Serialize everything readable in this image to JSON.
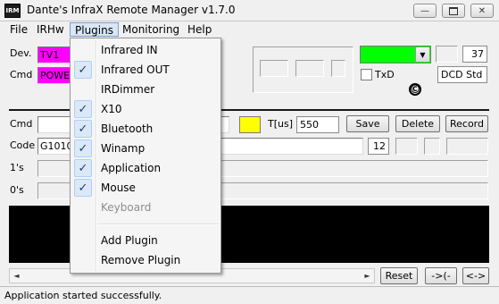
{
  "window": {
    "icon_text": "IRM",
    "title": "Dante's InfraX Remote Manager v1.7.0",
    "minimize_icon": "minimize-icon",
    "restore_icon": "restore-icon",
    "close_icon": "close-icon"
  },
  "menubar": {
    "file": "File",
    "irhw": "IRHw",
    "plugins": "Plugins",
    "monitoring": "Monitoring",
    "help": "Help"
  },
  "plugins_menu": {
    "items": [
      {
        "label": "Infrared IN",
        "checked": false,
        "enabled": true
      },
      {
        "label": "Infrared OUT",
        "checked": true,
        "enabled": true
      },
      {
        "label": "IRDimmer",
        "checked": false,
        "enabled": true
      },
      {
        "label": "X10",
        "checked": true,
        "enabled": true
      },
      {
        "label": "Bluetooth",
        "checked": true,
        "enabled": true
      },
      {
        "label": "Winamp",
        "checked": true,
        "enabled": true
      },
      {
        "label": "Application",
        "checked": true,
        "enabled": true
      },
      {
        "label": "Mouse",
        "checked": true,
        "enabled": true
      },
      {
        "label": "Keyboard",
        "checked": false,
        "enabled": false
      }
    ],
    "add_plugin": "Add Plugin",
    "remove_plugin": "Remove Plugin",
    "check_glyph": "✓"
  },
  "device": {
    "dev_label": "Dev.",
    "dev_value": "TV1",
    "cmd_label": "Cmd",
    "cmd_value": "POWER",
    "highlight_color": "#ff00ff"
  },
  "status_panel": {
    "led_color": "#00ff00",
    "count_value": "37",
    "txd_label": "TxD",
    "dcd_label": "DCD Std",
    "copyright_glyph": "©"
  },
  "command_row": {
    "cmd_label": "Cmd",
    "tus_label": "T[us]",
    "tus_value": "550",
    "indicator_color": "#ffff00",
    "save_button": "Save",
    "delete_button": "Delete",
    "record_button": "Record"
  },
  "code_row": {
    "code_label": "Code",
    "code_value": "G1010",
    "bits_value": "12"
  },
  "ones_label": "1's",
  "zeros_label": "0's",
  "bottom": {
    "scroll_left": "◄",
    "scroll_right": "►",
    "reset_button": "Reset",
    "prev_button": "->(-",
    "swap_button": "<->"
  },
  "status_bar": {
    "message": "Application started successfully."
  }
}
